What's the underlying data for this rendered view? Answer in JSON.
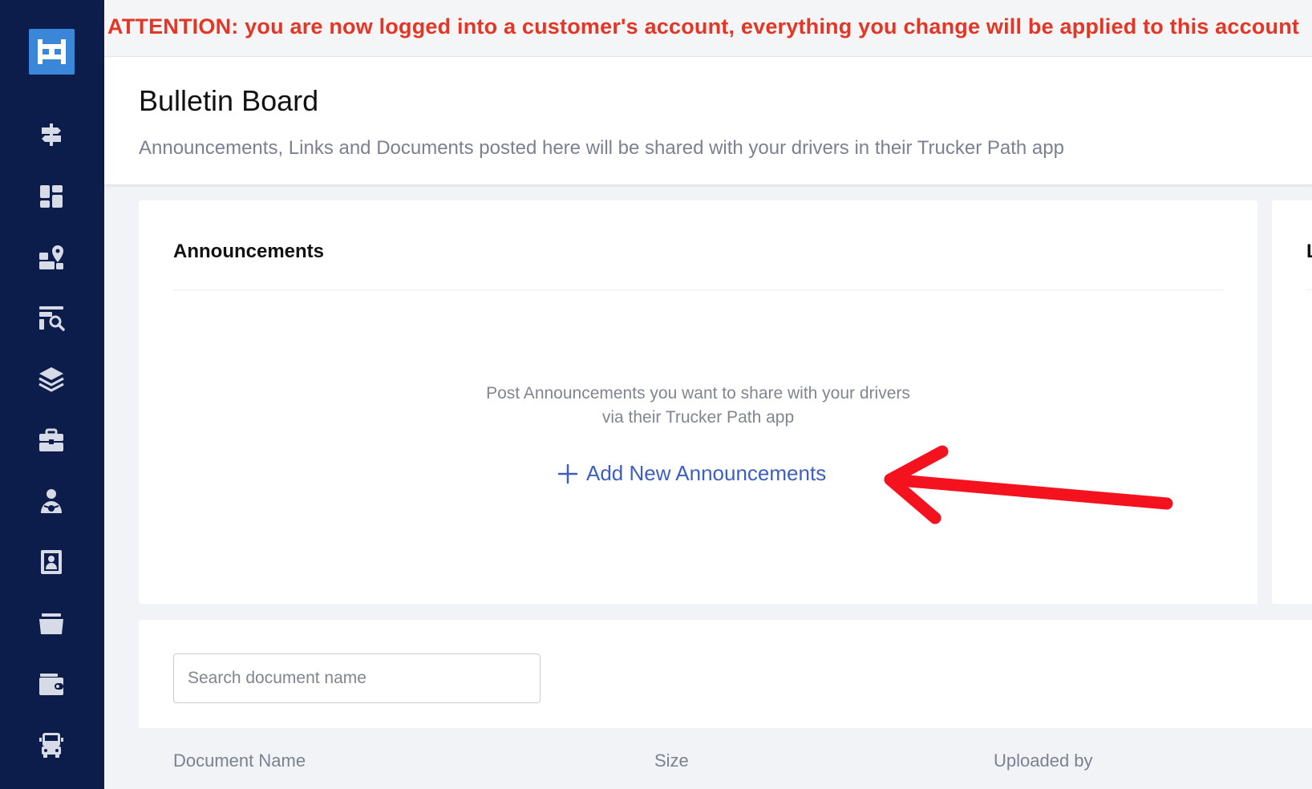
{
  "banner": {
    "text": "ATTENTION: you are now logged into a customer's account, everything you change will be applied to this account"
  },
  "sidebar": {
    "items": [
      {
        "icon": "signpost-icon"
      },
      {
        "icon": "dashboard-icon"
      },
      {
        "icon": "map-location-icon"
      },
      {
        "icon": "search-list-icon"
      },
      {
        "icon": "layers-icon"
      },
      {
        "icon": "briefcase-icon"
      },
      {
        "icon": "driver-icon"
      },
      {
        "icon": "contact-card-icon"
      },
      {
        "icon": "folder-icon"
      },
      {
        "icon": "wallet-icon"
      },
      {
        "icon": "truck-icon"
      }
    ]
  },
  "header": {
    "title": "Bulletin Board",
    "subtitle": "Announcements, Links and Documents posted here will be shared with your drivers in their Trucker Path app"
  },
  "announcements": {
    "title": "Announcements",
    "empty_line1": "Post Announcements you want to share with your drivers",
    "empty_line2": "via their Trucker Path app",
    "add_label": "Add New Announcements"
  },
  "right_card": {
    "title": "L"
  },
  "documents": {
    "search_placeholder": "Search document name",
    "columns": [
      "Document Name",
      "Size",
      "Uploaded by"
    ]
  },
  "colors": {
    "sidebar": "#0c1c4b",
    "logo": "#3a86d8",
    "attention": "#e53524",
    "link": "#3d5ec4",
    "annotation_arrow": "#f5121f"
  }
}
